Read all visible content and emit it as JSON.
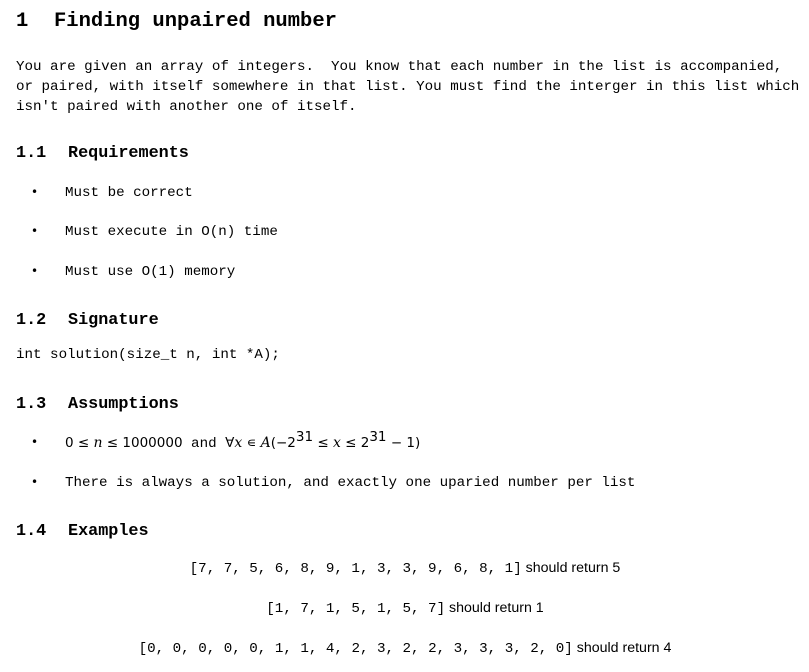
{
  "section": {
    "number": "1",
    "title": "Finding unpaired number"
  },
  "intro": [
    "You are given an array of integers.  You know that each number in the list is accompanied,",
    "or paired, with itself somewhere in that list. You must find the interger in this list which",
    "isn't paired with another one of itself."
  ],
  "requirements": {
    "number": "1.1",
    "title": "Requirements",
    "items": [
      "Must be correct",
      "Must execute in O(n) time",
      "Must use O(1) memory"
    ]
  },
  "signature": {
    "number": "1.2",
    "title": "Signature",
    "code": "int solution(size_t n, int *A);"
  },
  "assumptions": {
    "number": "1.3",
    "title": "Assumptions",
    "item1": {
      "p1": "0 ≤ ",
      "n": "n",
      "p2": " ≤ 1000000",
      "and": " and ",
      "forall": "∀",
      "x1": "x",
      "in": " ∊ ",
      "A": "A",
      "p3": "(−2",
      "e1": "31",
      "p4": " ≤ ",
      "x2": "x",
      "p5": " ≤ 2",
      "e2": "31",
      "p6": " − 1)"
    },
    "item2": "There is always a solution, and exactly one uparied number per list"
  },
  "examples": {
    "number": "1.4",
    "title": "Examples",
    "items": [
      {
        "array": "[7, 7, 5, 6, 8, 9, 1, 3, 3, 9, 6, 8, 1]",
        "tail": " should return 5"
      },
      {
        "array": "[1, 7, 1, 5, 1, 5, 7]",
        "tail": " should return 1"
      },
      {
        "array": "[0, 0, 0, 0, 0, 1, 1, 4, 2, 3, 2, 2, 3, 3, 3, 2, 0]",
        "tail": " should return 4"
      }
    ]
  }
}
